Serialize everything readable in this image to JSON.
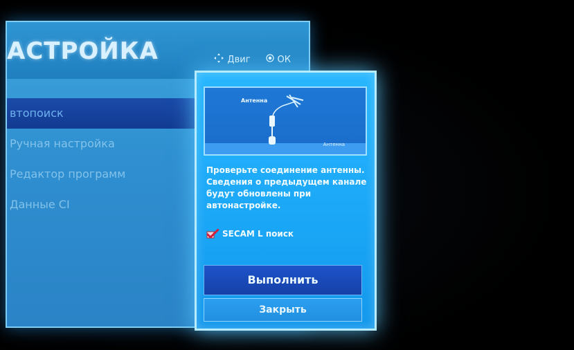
{
  "main": {
    "title": "АСТРОЙКА",
    "hint_move": "Двиг",
    "hint_ok": "ОК",
    "menu": [
      {
        "label": "втопоиск",
        "selected": true
      },
      {
        "label": "Ручная настройка",
        "selected": false
      },
      {
        "label": "Редактор программ",
        "selected": false
      },
      {
        "label": "Данные CI",
        "selected": false
      }
    ]
  },
  "popup": {
    "diagram_label_top": "Антенна",
    "diagram_label_bottom": "Антенна",
    "message": "Проверьте соединение антенны. Сведения о предыдущем канале будут обновлены при автонастройке.",
    "secam_label": "SECAM L поиск",
    "secam_checked": true,
    "run_button": "Выполнить",
    "close_button": "Закрыть"
  },
  "icons": {
    "move": "dpad-arrows-icon",
    "ok": "ok-dot-icon",
    "check": "checkmark-icon",
    "antenna": "antenna-icon",
    "connector": "cable-connector-icon"
  }
}
